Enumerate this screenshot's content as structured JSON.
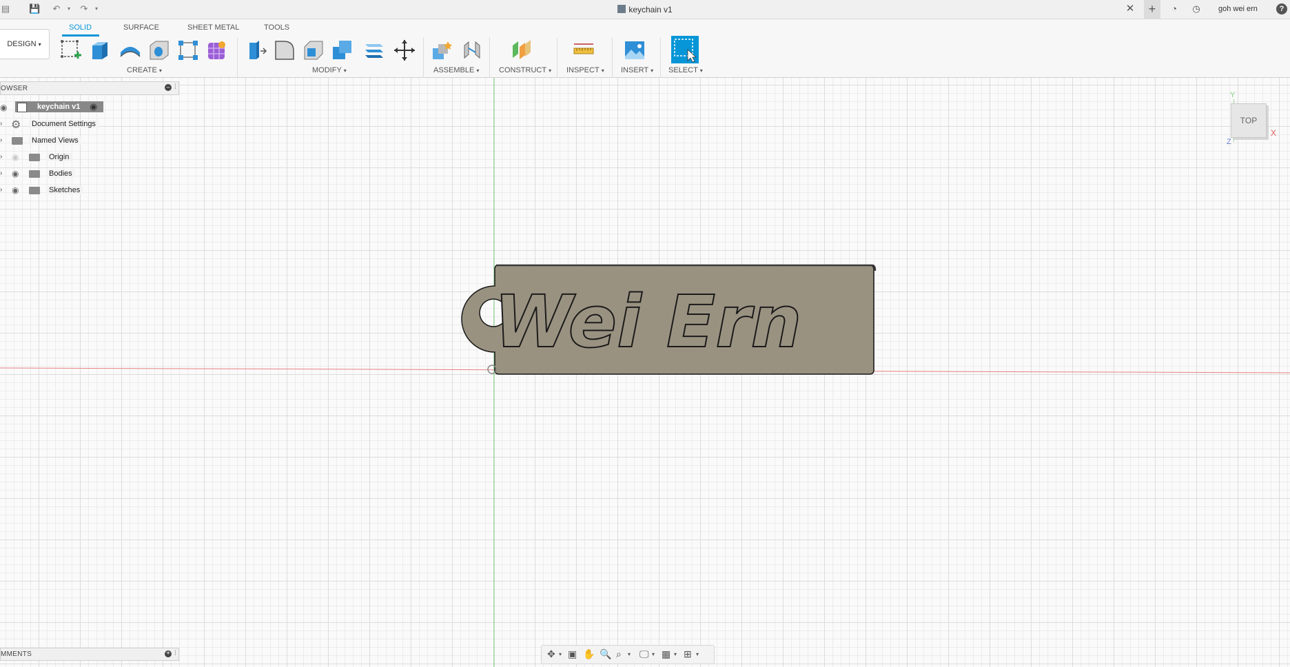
{
  "window": {
    "title": "keychain v1",
    "user": "goh wei ern"
  },
  "ribbon": {
    "tabs": [
      {
        "label": "SOLID",
        "active": true
      },
      {
        "label": "SURFACE",
        "active": false
      },
      {
        "label": "SHEET METAL",
        "active": false
      },
      {
        "label": "TOOLS",
        "active": false
      }
    ],
    "workspace": "DESIGN",
    "groups": {
      "create": "CREATE",
      "modify": "MODIFY",
      "assemble": "ASSEMBLE",
      "construct": "CONSTRUCT",
      "inspect": "INSPECT",
      "insert": "INSERT",
      "select": "SELECT"
    }
  },
  "browser": {
    "header": "OWSER",
    "items": [
      {
        "label": "keychain v1",
        "icon": "component-icon"
      },
      {
        "label": "Document Settings",
        "icon": "gear-icon"
      },
      {
        "label": "Named Views",
        "icon": "folder-icon"
      },
      {
        "label": "Origin",
        "icon": "folder-icon"
      },
      {
        "label": "Bodies",
        "icon": "folder-icon"
      },
      {
        "label": "Sketches",
        "icon": "folder-icon"
      }
    ]
  },
  "comments": {
    "header": "MMENTS"
  },
  "model": {
    "engraved_text": "Wei Ern"
  },
  "viewcube": {
    "face": "TOP",
    "axis_x": "X",
    "axis_y": "Y",
    "axis_z": "Z"
  },
  "colors": {
    "accent": "#0696d7",
    "model_fill": "#9a9281",
    "model_edge": "#1a1a1a",
    "axis_red": "#e88080",
    "axis_green": "#7ed17e"
  }
}
